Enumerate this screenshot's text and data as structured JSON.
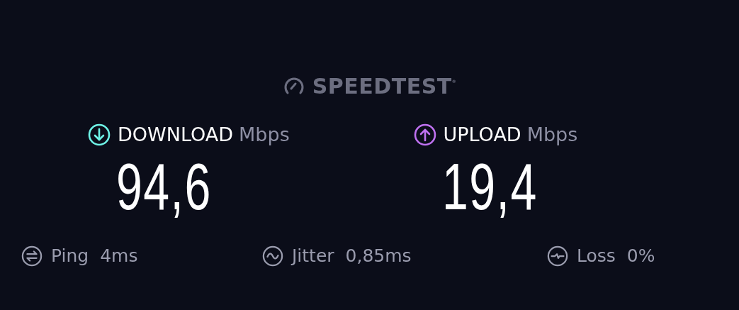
{
  "logo": {
    "text": "SPEEDTEST",
    "mark": "®"
  },
  "metrics": [
    {
      "kind": "download",
      "label": "DOWNLOAD",
      "unit": "Mbps",
      "value": "94,6",
      "color": "#6ef2e6"
    },
    {
      "kind": "upload",
      "label": "UPLOAD",
      "unit": "Mbps",
      "value": "19,4",
      "color": "#bf71f0"
    }
  ],
  "stats": [
    {
      "kind": "ping",
      "label": "Ping",
      "value": "4",
      "unit": "ms"
    },
    {
      "kind": "jitter",
      "label": "Jitter",
      "value": "0,85",
      "unit": "ms"
    },
    {
      "kind": "loss",
      "label": "Loss",
      "value": "0%"
    }
  ]
}
